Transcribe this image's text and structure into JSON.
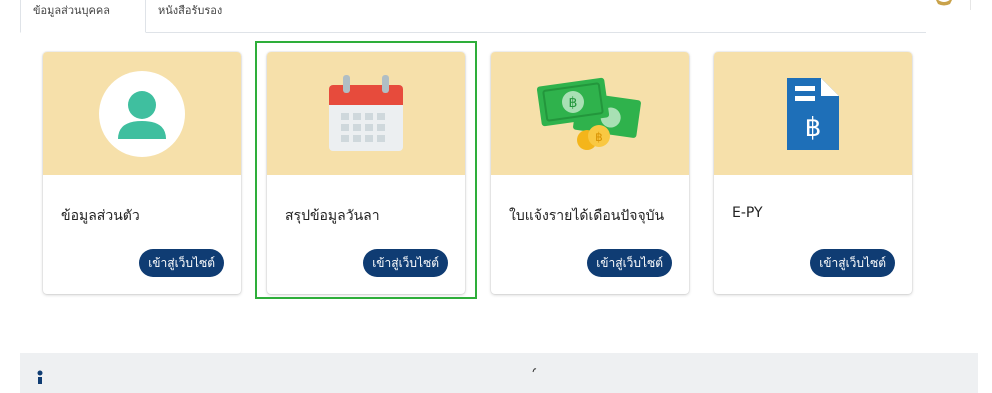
{
  "tabs": [
    {
      "label": "ข้อมูลส่วนบุคคล"
    },
    {
      "label": "หนังสือรับรอง"
    }
  ],
  "cards": [
    {
      "title": "ข้อมูลส่วนตัว",
      "button": "เข้าสู่เว็บไซต์",
      "icon": "user-avatar-icon"
    },
    {
      "title": "สรุปข้อมูลวันลา",
      "button": "เข้าสู่เว็บไซต์",
      "icon": "calendar-icon"
    },
    {
      "title": "ใบแจ้งรายได้เดือนปัจจุบัน",
      "button": "เข้าสู่เว็บไซต์",
      "icon": "money-bills-icon"
    },
    {
      "title": "E-PY",
      "button": "เข้าสู่เว็บไซต์",
      "icon": "baht-document-icon"
    }
  ],
  "colors": {
    "banner": "#f6e0aa",
    "button": "#0f3c73",
    "highlight": "#2eae3a",
    "avatar": "#3fbf9f",
    "calendar_red": "#e74b3c",
    "money_green": "#2fb24c",
    "coin_gold": "#f4b51b",
    "doc_blue": "#1e6fb8"
  }
}
